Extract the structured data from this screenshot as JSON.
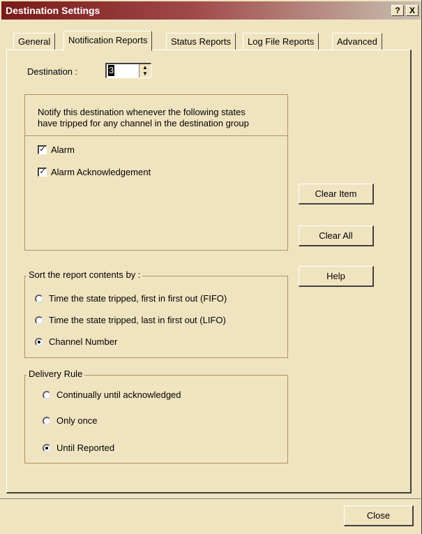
{
  "window": {
    "title": "Destination Settings",
    "help_button": "?",
    "close_button": "X"
  },
  "tabs": [
    {
      "label": "General",
      "active": false
    },
    {
      "label": "Notification Reports",
      "active": true
    },
    {
      "label": "Status Reports",
      "active": false
    },
    {
      "label": "Log File Reports",
      "active": false
    },
    {
      "label": "Advanced",
      "active": false
    }
  ],
  "destination": {
    "label": "Destination :",
    "value": "3",
    "up_arrow": "▲",
    "down_arrow": "▼"
  },
  "notify": {
    "line1": "Notify this destination whenever the following states",
    "line2": "have tripped for any channel in the destination group",
    "items": [
      {
        "label": "Alarm",
        "checked": true,
        "mark": "✓"
      },
      {
        "label": "Alarm Acknowledgement",
        "checked": true,
        "mark": "✓"
      }
    ]
  },
  "buttons": {
    "clear_item": "Clear Item",
    "clear_all": "Clear All",
    "help": "Help",
    "close": "Close"
  },
  "sort": {
    "legend": "Sort the report contents by :",
    "options": [
      {
        "label": "Time the state tripped, first in first out (FIFO)",
        "selected": false
      },
      {
        "label": "Time the state tripped, last in first out (LIFO)",
        "selected": false
      },
      {
        "label": "Channel Number",
        "selected": true
      }
    ]
  },
  "delivery": {
    "legend": "Delivery Rule",
    "options": [
      {
        "label": "Continually until acknowledged",
        "selected": false
      },
      {
        "label": "Only once",
        "selected": false
      },
      {
        "label": "Until Reported",
        "selected": true
      }
    ]
  }
}
